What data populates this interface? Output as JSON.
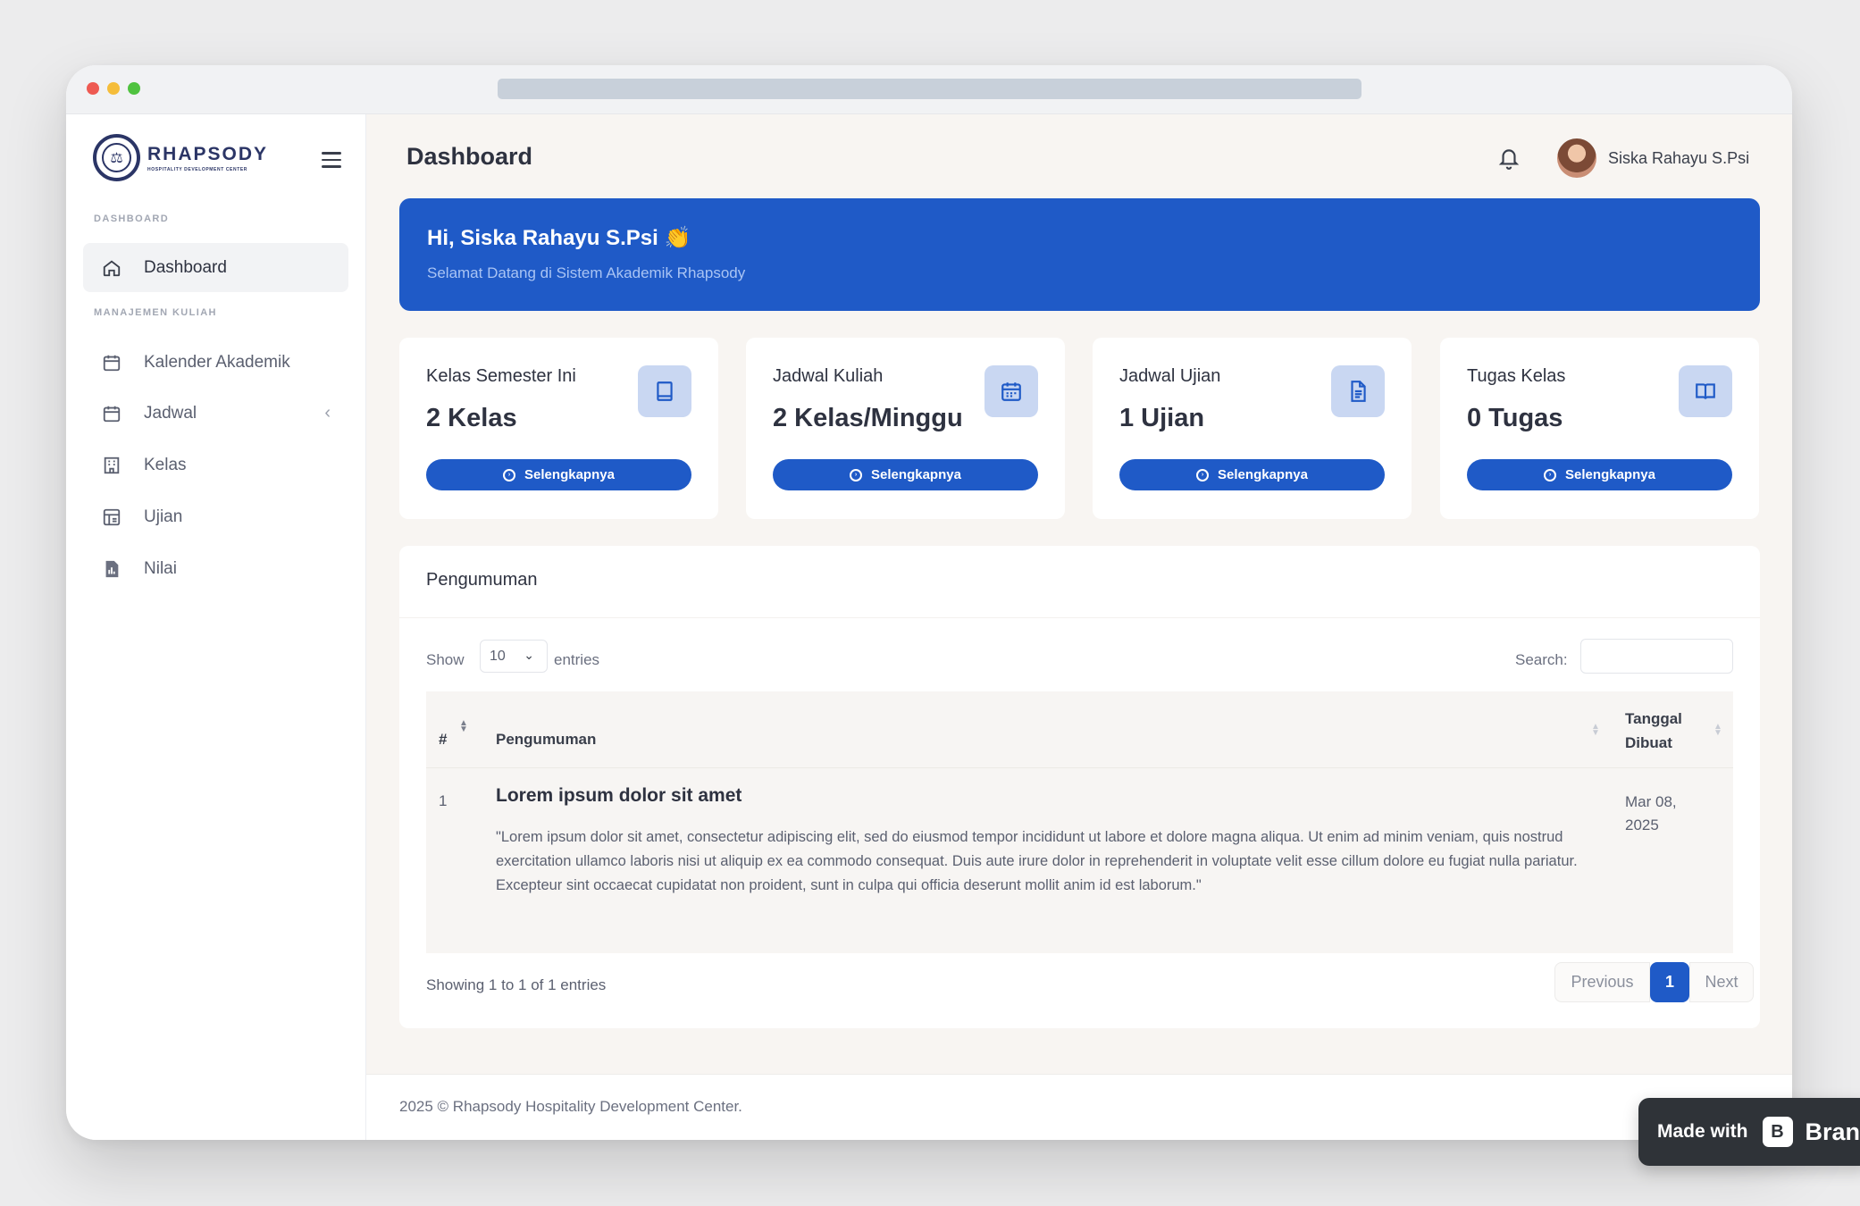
{
  "sidebar": {
    "logo_name": "RHAPSODY",
    "logo_sub": "HOSPITALITY DEVELOPMENT CENTER",
    "section_dashboard": "DASHBOARD",
    "section_manajemen": "MANAJEMEN KULIAH",
    "items": [
      {
        "label": "Dashboard",
        "icon": "home-icon",
        "active": true
      },
      {
        "label": "Kalender Akademik",
        "icon": "calendar-icon"
      },
      {
        "label": "Jadwal",
        "icon": "calendar-icon",
        "has_chevron": true
      },
      {
        "label": "Kelas",
        "icon": "building-icon"
      },
      {
        "label": "Ujian",
        "icon": "exam-icon"
      },
      {
        "label": "Nilai",
        "icon": "report-icon"
      }
    ]
  },
  "header": {
    "title": "Dashboard",
    "username": "Siska Rahayu S.Psi"
  },
  "banner": {
    "greeting": "Hi, Siska Rahayu S.Psi 👏",
    "subtitle": "Selamat Datang di Sistem Akademik Rhapsody"
  },
  "cards": [
    {
      "label": "Kelas Semester Ini",
      "value": "2 Kelas",
      "button": "Selengkapnya",
      "icon": "book-icon"
    },
    {
      "label": "Jadwal Kuliah",
      "value": "2 Kelas/Minggu",
      "button": "Selengkapnya",
      "icon": "calendar-icon"
    },
    {
      "label": "Jadwal Ujian",
      "value": "1 Ujian",
      "button": "Selengkapnya",
      "icon": "document-icon"
    },
    {
      "label": "Tugas Kelas",
      "value": "0 Tugas",
      "button": "Selengkapnya",
      "icon": "open-book-icon"
    }
  ],
  "announcements": {
    "title": "Pengumuman",
    "show_label": "Show",
    "entries_value": "10",
    "entries_label": "entries",
    "search_label": "Search:",
    "columns": [
      "#",
      "Pengumuman",
      "Tanggal Dibuat"
    ],
    "rows": [
      {
        "num": "1",
        "title": "Lorem ipsum dolor sit amet",
        "body": "\"Lorem ipsum dolor sit amet, consectetur adipiscing elit, sed do eiusmod tempor incididunt ut labore et dolore magna aliqua. Ut enim ad minim veniam, quis nostrud exercitation ullamco laboris nisi ut aliquip ex ea commodo consequat. Duis aute irure dolor in reprehenderit in voluptate velit esse cillum dolore eu fugiat nulla pariatur. Excepteur sint occaecat cupidatat non proident, sunt in culpa qui officia deserunt mollit anim id est laborum.\"",
        "date": "Mar 08, 2025"
      }
    ],
    "showing": "Showing 1 to 1 of 1 entries",
    "pagination": {
      "previous": "Previous",
      "current": "1",
      "next": "Next"
    }
  },
  "footer": {
    "text": "2025 © Rhapsody Hospitality Development Center."
  },
  "badge": {
    "made_with": "Made with",
    "brand": "Bran"
  },
  "colors": {
    "primary": "#1f5ac7",
    "card_icon_bg": "#c9d7f2",
    "main_bg": "#f8f5f2"
  }
}
